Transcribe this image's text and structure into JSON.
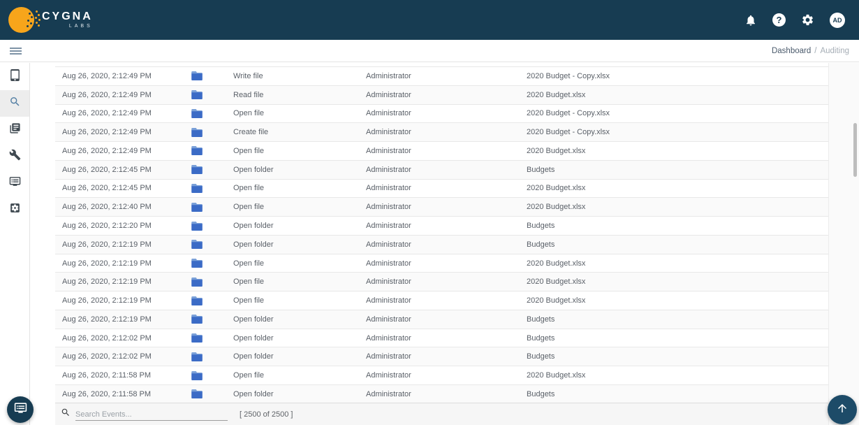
{
  "header": {
    "brand": "CYGNA",
    "brand_sub": "LABS",
    "help_glyph": "?",
    "avatar_label": "AD",
    "icons": [
      "notifications-bell",
      "help",
      "settings-gear",
      "user-avatar"
    ]
  },
  "toolbar": {
    "breadcrumb": {
      "items": [
        "Dashboard",
        "Auditing"
      ],
      "separator": "/"
    }
  },
  "sidebar": {
    "items": [
      {
        "name": "devices",
        "icon": "tablet-icon",
        "active": false
      },
      {
        "name": "search",
        "icon": "search-icon",
        "active": true
      },
      {
        "name": "reports",
        "icon": "library-icon",
        "active": false
      },
      {
        "name": "tools",
        "icon": "wrench-icon",
        "active": false
      },
      {
        "name": "console",
        "icon": "dvr-icon",
        "active": false
      },
      {
        "name": "app-settings",
        "icon": "gear-box-icon",
        "active": false
      }
    ]
  },
  "table": {
    "rows": [
      {
        "timestamp": "Aug 26, 2020, 2:12:49 PM",
        "icon": "folder",
        "action": "Write file",
        "user": "Administrator",
        "target": "2020 Budget - Copy.xlsx"
      },
      {
        "timestamp": "Aug 26, 2020, 2:12:49 PM",
        "icon": "folder",
        "action": "Read file",
        "user": "Administrator",
        "target": "2020 Budget.xlsx"
      },
      {
        "timestamp": "Aug 26, 2020, 2:12:49 PM",
        "icon": "folder",
        "action": "Open file",
        "user": "Administrator",
        "target": "2020 Budget - Copy.xlsx"
      },
      {
        "timestamp": "Aug 26, 2020, 2:12:49 PM",
        "icon": "folder",
        "action": "Create file",
        "user": "Administrator",
        "target": "2020 Budget - Copy.xlsx"
      },
      {
        "timestamp": "Aug 26, 2020, 2:12:49 PM",
        "icon": "folder",
        "action": "Open file",
        "user": "Administrator",
        "target": "2020 Budget.xlsx"
      },
      {
        "timestamp": "Aug 26, 2020, 2:12:45 PM",
        "icon": "folder",
        "action": "Open folder",
        "user": "Administrator",
        "target": "Budgets"
      },
      {
        "timestamp": "Aug 26, 2020, 2:12:45 PM",
        "icon": "folder",
        "action": "Open file",
        "user": "Administrator",
        "target": "2020 Budget.xlsx"
      },
      {
        "timestamp": "Aug 26, 2020, 2:12:40 PM",
        "icon": "folder",
        "action": "Open file",
        "user": "Administrator",
        "target": "2020 Budget.xlsx"
      },
      {
        "timestamp": "Aug 26, 2020, 2:12:20 PM",
        "icon": "folder",
        "action": "Open folder",
        "user": "Administrator",
        "target": "Budgets"
      },
      {
        "timestamp": "Aug 26, 2020, 2:12:19 PM",
        "icon": "folder",
        "action": "Open folder",
        "user": "Administrator",
        "target": "Budgets"
      },
      {
        "timestamp": "Aug 26, 2020, 2:12:19 PM",
        "icon": "folder",
        "action": "Open file",
        "user": "Administrator",
        "target": "2020 Budget.xlsx"
      },
      {
        "timestamp": "Aug 26, 2020, 2:12:19 PM",
        "icon": "folder",
        "action": "Open file",
        "user": "Administrator",
        "target": "2020 Budget.xlsx"
      },
      {
        "timestamp": "Aug 26, 2020, 2:12:19 PM",
        "icon": "folder",
        "action": "Open file",
        "user": "Administrator",
        "target": "2020 Budget.xlsx"
      },
      {
        "timestamp": "Aug 26, 2020, 2:12:19 PM",
        "icon": "folder",
        "action": "Open folder",
        "user": "Administrator",
        "target": "Budgets"
      },
      {
        "timestamp": "Aug 26, 2020, 2:12:02 PM",
        "icon": "folder",
        "action": "Open folder",
        "user": "Administrator",
        "target": "Budgets"
      },
      {
        "timestamp": "Aug 26, 2020, 2:12:02 PM",
        "icon": "folder",
        "action": "Open folder",
        "user": "Administrator",
        "target": "Budgets"
      },
      {
        "timestamp": "Aug 26, 2020, 2:11:58 PM",
        "icon": "folder",
        "action": "Open file",
        "user": "Administrator",
        "target": "2020 Budget.xlsx"
      },
      {
        "timestamp": "Aug 26, 2020, 2:11:58 PM",
        "icon": "folder",
        "action": "Open folder",
        "user": "Administrator",
        "target": "Budgets"
      }
    ]
  },
  "footer": {
    "search_placeholder": "Search Events...",
    "count": "[ 2500 of 2500 ]"
  },
  "colors": {
    "header_navy": "#173C52",
    "fab_navy": "#1D4B68",
    "logo_orange": "#F7A51B",
    "folder_blue": "#3B6BC6",
    "active_icon_blue": "#527EA3"
  }
}
